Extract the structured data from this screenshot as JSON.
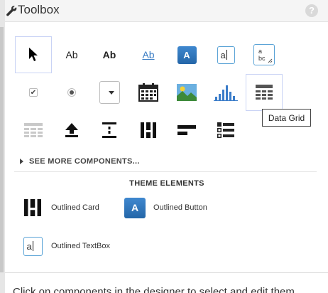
{
  "header": {
    "title": "Toolbox",
    "help_label": "?"
  },
  "toolbox": {
    "tiles": [
      {
        "icon": "pointer-icon"
      },
      {
        "icon": "label-icon",
        "text": "Ab"
      },
      {
        "icon": "bold-label-icon",
        "text": "Ab"
      },
      {
        "icon": "hyperlink-icon",
        "text": "Ab"
      },
      {
        "icon": "button-icon",
        "text": "A"
      },
      {
        "icon": "textbox-icon",
        "text": "a"
      },
      {
        "icon": "textarea-icon",
        "text_line1": "a",
        "text_line2": "bc"
      },
      {
        "icon": "checkbox-icon"
      },
      {
        "icon": "radio-button-icon"
      },
      {
        "icon": "dropdown-icon"
      },
      {
        "icon": "calendar-icon"
      },
      {
        "icon": "image-icon"
      },
      {
        "icon": "chart-icon"
      },
      {
        "icon": "data-grid-icon"
      },
      {
        "icon": "repeater-icon"
      },
      {
        "icon": "upload-icon"
      },
      {
        "icon": "spacer-icon"
      },
      {
        "icon": "card-icon"
      },
      {
        "icon": "progress-bar-icon"
      },
      {
        "icon": "list-icon"
      }
    ],
    "tooltip": "Data Grid",
    "see_more": "SEE MORE COMPONENTS..."
  },
  "theme": {
    "title": "THEME ELEMENTS",
    "items": [
      {
        "label": "Outlined Card",
        "icon": "outlined-card-icon"
      },
      {
        "label": "Outlined Button",
        "icon": "outlined-button-icon",
        "text": "A"
      },
      {
        "label": "Outlined TextBox",
        "icon": "outlined-textbox-icon",
        "text": "a"
      }
    ]
  },
  "footer": {
    "text": "Click on components in the designer to select and edit them"
  },
  "colors": {
    "accent": "#2f78bf",
    "selection": "#c9d3f5",
    "header_bg": "#f5f5f5"
  }
}
